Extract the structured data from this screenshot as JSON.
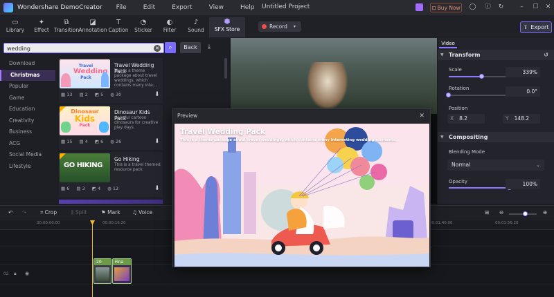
{
  "app": {
    "name": "Wondershare DemoCreator",
    "window_title": "Untitled Project",
    "buy_now": "Buy Now",
    "menu": [
      "File",
      "Edit",
      "Export",
      "View",
      "Help"
    ]
  },
  "toolbar": {
    "tools": [
      {
        "label": "Library",
        "icon": "folder-icon"
      },
      {
        "label": "Effect",
        "icon": "effect-icon"
      },
      {
        "label": "Transition",
        "icon": "transition-icon"
      },
      {
        "label": "Annotation",
        "icon": "annotation-icon"
      },
      {
        "label": "Caption",
        "icon": "caption-icon"
      },
      {
        "label": "Sticker",
        "icon": "sticker-icon"
      },
      {
        "label": "Filter",
        "icon": "filter-icon"
      },
      {
        "label": "Sound",
        "icon": "sound-icon"
      },
      {
        "label": "SFX Store",
        "icon": "store-icon",
        "active": true
      }
    ],
    "record_label": "Record",
    "export_label": "Export"
  },
  "search": {
    "value": "wedding",
    "back_label": "Back"
  },
  "categories": [
    "Download",
    "Christmas",
    "Popular",
    "Game",
    "Education",
    "Creativity",
    "Business",
    "ACG",
    "Social Media",
    "Lifestyle"
  ],
  "active_category": "Christmas",
  "packs": [
    {
      "title": "Travel Wedding Pack",
      "desc": "This is a theme package about travel weddings, which contains many inte...",
      "stats": [
        "13",
        "2",
        "5",
        "30"
      ]
    },
    {
      "title": "Dinosaur Kids Pack",
      "desc": "Colorful cartoon dinosaurs for creative play days.",
      "stats": [
        "15",
        "4",
        "6",
        "26"
      ]
    },
    {
      "title": "Go Hiking",
      "desc": "This is a travel themed resource pack",
      "stats": [
        "6",
        "3",
        "4",
        "12"
      ]
    }
  ],
  "thumb_text": {
    "travel": "Travel",
    "wedding": "Wedding",
    "pack": "Pack",
    "dinosaur": "Dinosaur",
    "kids": "Kids",
    "hiking": "GO HIKING"
  },
  "properties": {
    "tab": "Video",
    "transform_label": "Transform",
    "scale_label": "Scale",
    "scale_value": "339%",
    "scale_fraction": 0.52,
    "rotation_label": "Rotation",
    "rotation_value": "0.0°",
    "rotation_fraction": 0.0,
    "position_label": "Position",
    "x_label": "X",
    "x_value": "8.2",
    "y_label": "Y",
    "y_value": "148.2",
    "compositing_label": "Compositing",
    "blending_label": "Blending Mode",
    "blending_value": "Normal",
    "opacity_label": "Opacity",
    "opacity_value": "100%",
    "opacity_fraction": 1.0
  },
  "timeline": {
    "tools": [
      "Crop",
      "Split",
      "Mark",
      "Voice"
    ],
    "ruler": [
      "00:00:00:00",
      "00:00:16:20",
      "00:01:40:00",
      "00:01:56:20"
    ],
    "track_number": "02",
    "clips": [
      "20",
      "20",
      "Fina"
    ]
  },
  "preview": {
    "header": "Preview",
    "title": "Travel Wedding Pack",
    "subtitle": "This is a theme package about travel weddings, which contains many interesting wedding elements."
  },
  "colors": {
    "accent": "#7b6cff",
    "record": "#ef4d4d",
    "playhead": "#f5b92d"
  }
}
